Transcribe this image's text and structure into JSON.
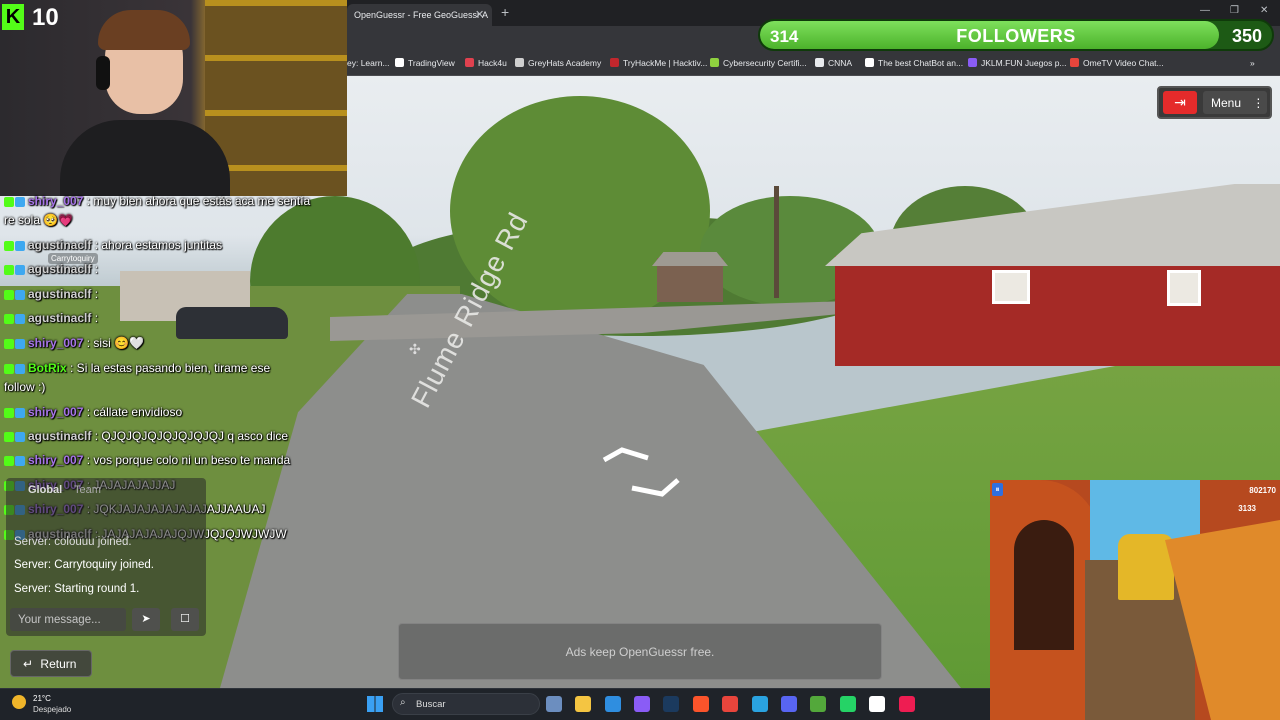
{
  "stream": {
    "platform_badge": "K",
    "viewer_count": "10",
    "follower_goal": {
      "current": "314",
      "label": "FOLLOWERS",
      "target": "350",
      "progress": 0.897
    }
  },
  "browser": {
    "tab_title": "OpenGuessr - Free GeoGuessr A",
    "bookmarks": [
      {
        "label": "ey: Learn...",
        "icon": "bookmark-icon",
        "color": "#ffffff"
      },
      {
        "label": "TradingView",
        "icon": "tradingview-icon",
        "color": "#ffffff"
      },
      {
        "label": "Hack4u",
        "icon": "hack4u-icon",
        "color": "#e0414f"
      },
      {
        "label": "GreyHats Academy",
        "icon": "greyhats-icon",
        "color": "#cfcfcf"
      },
      {
        "label": "TryHackMe | Hacktiv...",
        "icon": "tryhackme-icon",
        "color": "#c1272d"
      },
      {
        "label": "Cybersecurity Certifi...",
        "icon": "cyber-icon",
        "color": "#8fd13f"
      },
      {
        "label": "CNNA",
        "icon": "folder-icon",
        "color": "#e8eaed"
      },
      {
        "label": "The best ChatBot an...",
        "icon": "chatbot-icon",
        "color": "#ffffff"
      },
      {
        "label": "JKLM.FUN Juegos p...",
        "icon": "jklm-icon",
        "color": "#8a5cf6"
      },
      {
        "label": "OmeTV Video Chat...",
        "icon": "ometv-icon",
        "color": "#e8453c"
      }
    ]
  },
  "game": {
    "street_sign": "Flume Ridge Rd",
    "menu_label": "Menu",
    "chat_tabs": [
      "Global",
      "Team"
    ],
    "server_messages": [
      "Server: colouuu joined.",
      "Server: Carrytoquiry joined.",
      "Server: Starting round 1."
    ],
    "message_placeholder": "Your message...",
    "return_label": "Return",
    "ad_text": "Ads keep OpenGuessr free.",
    "player_label": "Carrytoquiry"
  },
  "chat": [
    {
      "user": "shiry_007",
      "text": ": muy bien ahora que estás aca  me sentía",
      "color": "#a774e8"
    },
    {
      "user": "",
      "text": "re sola 🥺💗",
      "color": "#ffffff"
    },
    {
      "user": "agustinaclf",
      "text": ": ahora estamos juntitas",
      "color": "#d0d0d0"
    },
    {
      "user": "agustinaclf",
      "text": ":",
      "color": "#d0d0d0"
    },
    {
      "user": "agustinaclf",
      "text": ":",
      "color": "#d0d0d0"
    },
    {
      "user": "agustinaclf",
      "text": ":",
      "color": "#d0d0d0"
    },
    {
      "user": "shiry_007",
      "text": ": sisi 😊🤍",
      "color": "#a774e8"
    },
    {
      "user": "BotRix",
      "text": ": Si la estas pasando bien, tirame ese",
      "color": "#53fc18"
    },
    {
      "user": "",
      "text": "follow :)",
      "color": "#ffffff"
    },
    {
      "user": "shiry_007",
      "text": ": cállate envidioso",
      "color": "#a774e8"
    },
    {
      "user": "agustinaclf",
      "text": ": QJQJQJQJQJQJQJQJ q asco dice",
      "color": "#d0d0d0"
    },
    {
      "user": "shiry_007",
      "text": ": vos porque colo ni un beso te manda",
      "color": "#a774e8"
    },
    {
      "user": "shiry_007",
      "text": ": JAJAJAJAJJAJ",
      "color": "#a774e8"
    },
    {
      "user": "shiry_007",
      "text": ": JQKJAJAJAJAJAJAJAJJAAUAJ",
      "color": "#a774e8"
    },
    {
      "user": "agustinaclf",
      "text": ": JAJAJAJAJAJQJWJQJQJWJWJW",
      "color": "#d0d0d0"
    }
  ],
  "taskbar": {
    "temperature": "21°C",
    "weather": "Despejado",
    "search_label": "Buscar"
  },
  "subway": {
    "score": "802170",
    "coins": "3133"
  }
}
